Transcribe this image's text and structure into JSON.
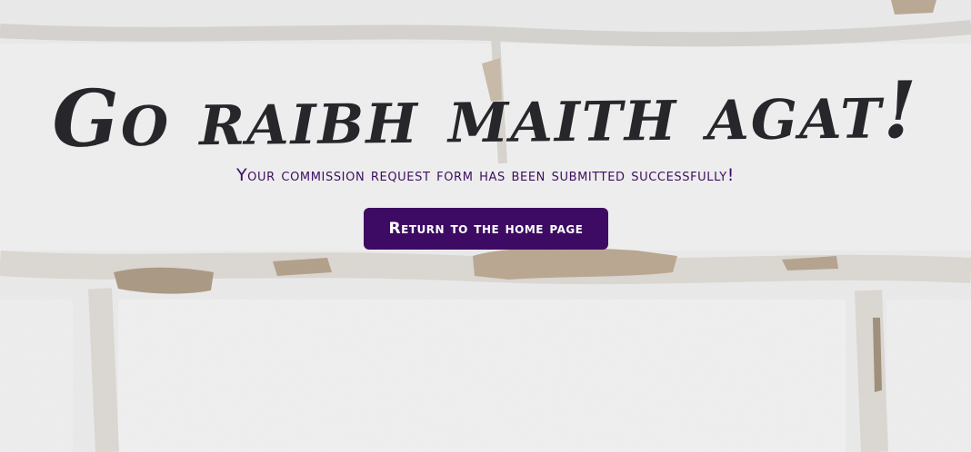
{
  "hero": {
    "title": "Go raibh maith agat!",
    "subtitle": "Your commission request form has been submitted successfully!"
  },
  "actions": {
    "home_button_label": "Return to the home page"
  },
  "background": {
    "description_icon": "brick-wall-texture"
  },
  "colors": {
    "title": "#26262b",
    "subtitle": "#3c0f60",
    "button_bg": "#3d0b63",
    "button_text": "#ffffff",
    "wall": "#eeeeee"
  }
}
